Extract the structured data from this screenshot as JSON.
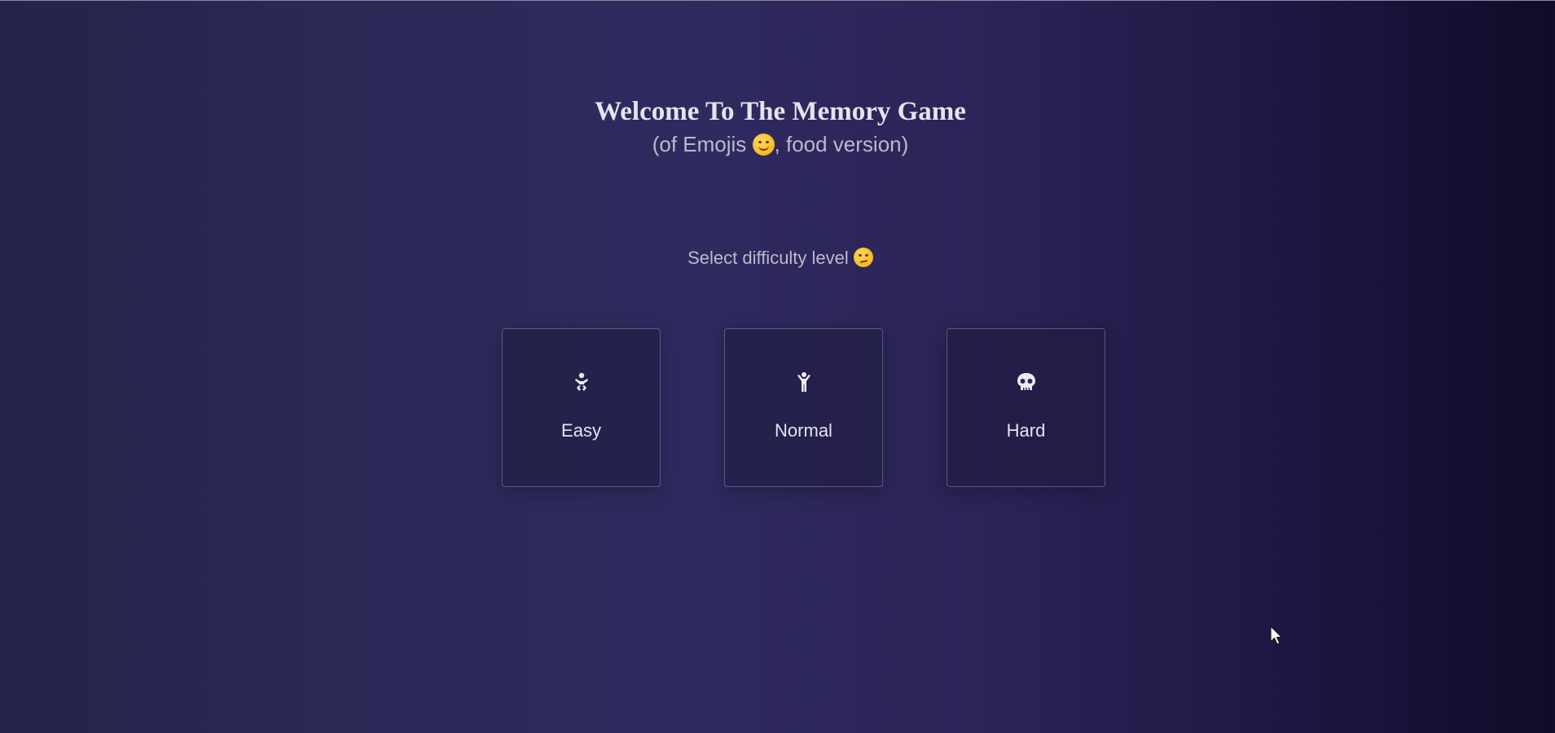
{
  "header": {
    "title": "Welcome To The Memory Game",
    "subtitle_prefix": "(of Emojis ",
    "subtitle_suffix": ", food version)"
  },
  "difficulty": {
    "prompt": "Select difficulty level "
  },
  "levels": [
    {
      "label": "Easy",
      "icon": "baby-icon"
    },
    {
      "label": "Normal",
      "icon": "child-icon"
    },
    {
      "label": "Hard",
      "icon": "skull-icon"
    }
  ],
  "colors": {
    "text": "#e6e3ee",
    "muted_text": "#bdb9cc",
    "emoji_yellow": "#f6b825"
  }
}
